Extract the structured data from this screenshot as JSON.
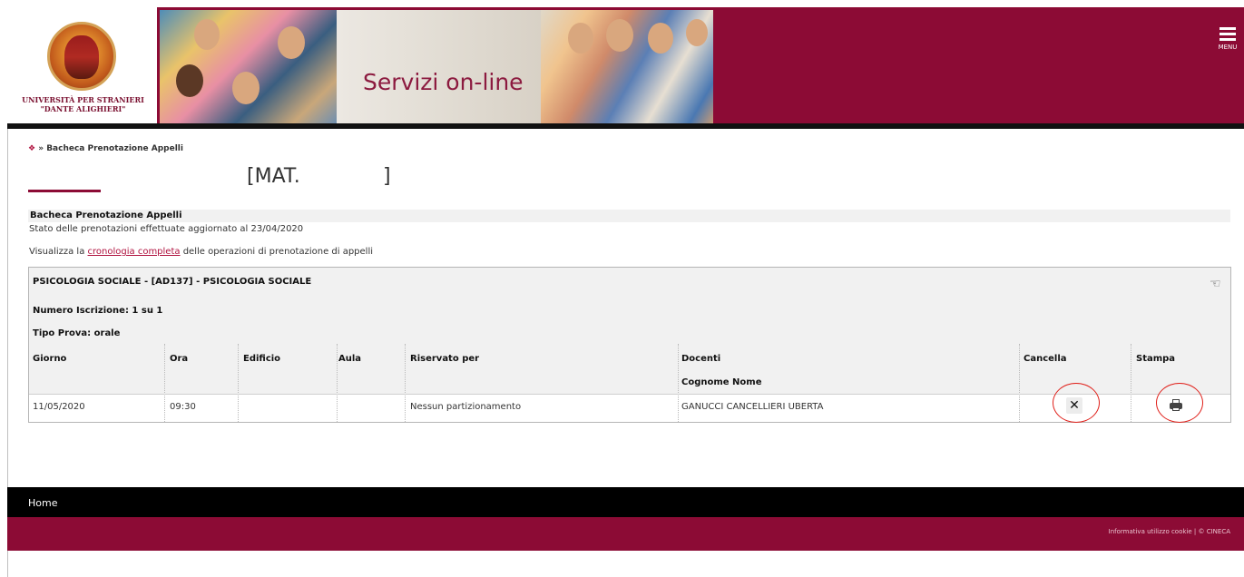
{
  "header": {
    "university_name_line1": "UNIVERSITÀ PER STRANIERI",
    "university_name_line2": "\"DANTE ALIGHIERI\"",
    "banner_text": "Servizi on-line",
    "menu_label": "MENU",
    "brand_color": "#8c0b35"
  },
  "breadcrumb": {
    "home_icon": "home-icon",
    "separator": "»",
    "current": "Bacheca Prenotazione Appelli"
  },
  "student": {
    "matricola_open": "[MAT.",
    "matricola_close": "]"
  },
  "board": {
    "heading": "Bacheca Prenotazione Appelli",
    "status_text": "Stato delle prenotazioni effettuate aggiornato al 23/04/2020",
    "history_prefix": "Visualizza la ",
    "history_link": "cronologia completa",
    "history_suffix": " delle operazioni di prenotazione di appelli"
  },
  "exam": {
    "title": "PSICOLOGIA SOCIALE - [AD137] - PSICOLOGIA SOCIALE",
    "numero_iscrizione": "Numero Iscrizione: 1 su 1",
    "tipo_prova": "Tipo Prova: orale",
    "columns": {
      "giorno": "Giorno",
      "ora": "Ora",
      "edificio": "Edificio",
      "aula": "Aula",
      "riservato": "Riservato per",
      "docenti": "Docenti",
      "docenti_sub": "Cognome Nome",
      "cancella": "Cancella",
      "stampa": "Stampa"
    },
    "row": {
      "giorno": "11/05/2020",
      "ora": "09:30",
      "edificio": "",
      "aula": "",
      "riservato": "Nessun partizionamento",
      "docente": "GANUCCI CANCELLIERI UBERTA",
      "cancel_icon": "close-icon",
      "print_icon": "printer-icon"
    }
  },
  "footer": {
    "home_link": "Home",
    "legal": "Informativa utilizzo cookie | © CINECA"
  }
}
